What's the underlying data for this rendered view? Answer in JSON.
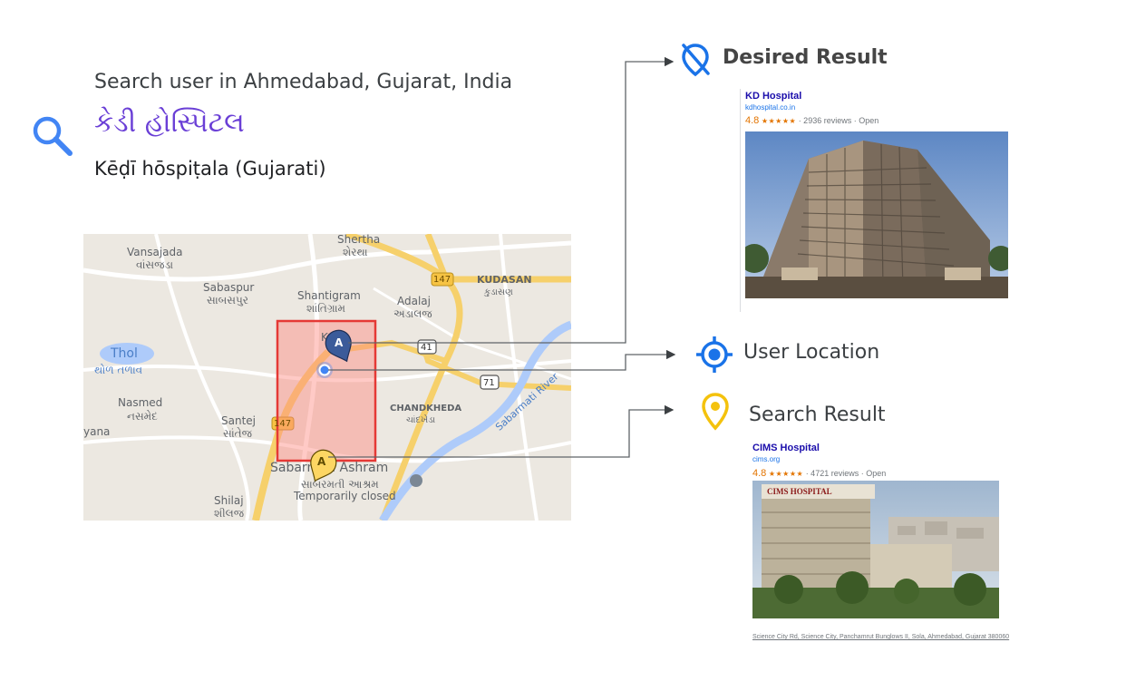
{
  "query": {
    "intro": "Search user in Ahmedabad, Gujarat, India",
    "gujarati": "કેડી હોસ્પિટલ",
    "transliteration": "Kēḍī hōspiṭala (Gujarati)"
  },
  "legend": {
    "desired": "Desired Result",
    "user_location": "User Location",
    "search_result": "Search Result"
  },
  "map_labels": {
    "vansajada": "Vansajada",
    "vansajada_g": "વાંસજડા",
    "sabaspur": "Sabaspur",
    "sabaspur_g": "સાબસપુર",
    "shantigram": "Shantigram",
    "shantigram_g": "શાંતિગ્રામ",
    "shertha": "Shertha",
    "shertha_g": "શેરથા",
    "adalaj": "Adalaj",
    "adalaj_g": "અડાલજ",
    "kudasan": "KUDASAN",
    "kudasan_g": "કુડાસણ",
    "koba": "Koba",
    "thol": "Thol",
    "thol_g": "થોળ તળાવ",
    "nasmed": "Nasmed",
    "nasmed_g": "નસમેદ",
    "santej": "Santej",
    "santej_g": "સાંતેજ",
    "chandkheda": "CHANDKHEDA",
    "chandkheda_g": "ચાંદખેડા",
    "sabarmati": "Sabarmati Ashram",
    "sabarmati_g": "સાબરમતી આશ્રમ",
    "temp_closed": "Temporarily closed",
    "shilaj": "Shilaj",
    "shilaj_g": "શીલજ",
    "river": "Sabarmati River",
    "yana": "yana",
    "r147a": "147",
    "r147b": "147",
    "r41": "41",
    "r71": "71",
    "marker": "A"
  },
  "desired_card": {
    "title": "KD Hospital",
    "url": "kdhospital.co.in",
    "rating": "4.8",
    "stars": "★★★★★",
    "reviews": "· 2936 reviews · Open"
  },
  "search_card": {
    "title": "CIMS Hospital",
    "url": "cims.org",
    "rating": "4.8",
    "stars": "★★★★★",
    "reviews": "· 4721 reviews · Open",
    "sign": "CIMS HOSPITAL",
    "address": "Science City Rd, Science City, Panchamrut Bunglows II, Sola, Ahmedabad, Gujarat 380060"
  },
  "colors": {
    "google_blue": "#4285f4",
    "pin_yellow": "#f4c20d",
    "gujarati_text": "#6a3fd6",
    "highlight_red": "#e53935"
  },
  "icons": {
    "search": "search-icon",
    "desired": "location-off-icon",
    "user": "my-location-icon",
    "result": "place-pin-icon"
  }
}
